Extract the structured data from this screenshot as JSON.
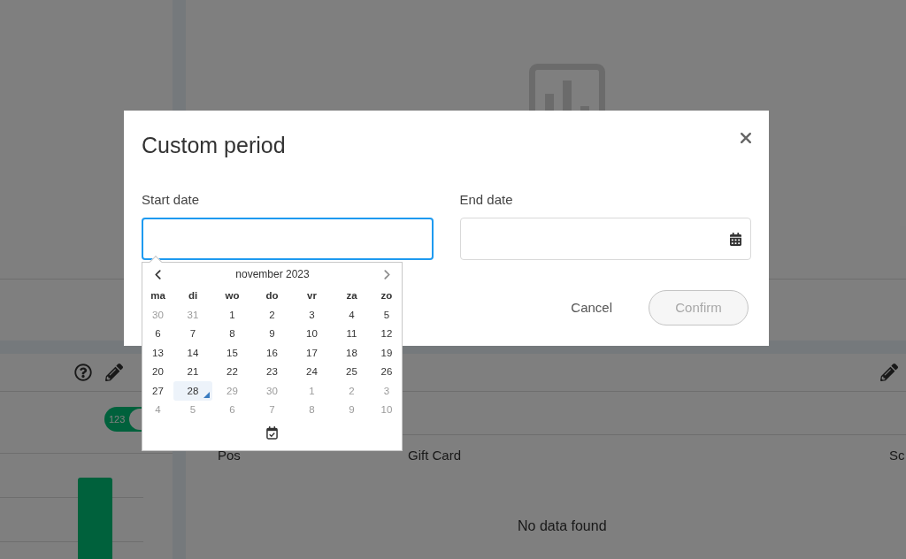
{
  "dashboard": {
    "switch": {
      "label": "123",
      "on": true
    },
    "table": {
      "columns": [
        "Pos",
        "Gift Card",
        "Sc"
      ],
      "empty_message": "No data found"
    }
  },
  "dialog": {
    "title": "Custom period",
    "fields": [
      {
        "label": "Start date",
        "focused": true
      },
      {
        "label": "End date",
        "focused": false
      }
    ],
    "buttons": [
      {
        "label": "Cancel",
        "kind": "text",
        "disabled": false
      },
      {
        "label": "Confirm",
        "kind": "outline",
        "disabled": true
      }
    ]
  },
  "datepicker": {
    "month": "november 2023",
    "prev_month": {
      "disabled": false
    },
    "next_month": {
      "disabled": true
    },
    "weekdays": [
      "ma",
      "di",
      "wo",
      "do",
      "vr",
      "za",
      "zo"
    ],
    "weeks": [
      [
        {
          "label": "30",
          "dimmed": true,
          "today": false
        },
        {
          "label": "31",
          "dimmed": true,
          "today": false
        },
        {
          "label": "1",
          "dimmed": false,
          "today": false
        },
        {
          "label": "2",
          "dimmed": false,
          "today": false
        },
        {
          "label": "3",
          "dimmed": false,
          "today": false
        },
        {
          "label": "4",
          "dimmed": false,
          "today": false
        },
        {
          "label": "5",
          "dimmed": false,
          "today": false
        }
      ],
      [
        {
          "label": "6",
          "dimmed": false,
          "today": false
        },
        {
          "label": "7",
          "dimmed": false,
          "today": false
        },
        {
          "label": "8",
          "dimmed": false,
          "today": false
        },
        {
          "label": "9",
          "dimmed": false,
          "today": false
        },
        {
          "label": "10",
          "dimmed": false,
          "today": false
        },
        {
          "label": "11",
          "dimmed": false,
          "today": false
        },
        {
          "label": "12",
          "dimmed": false,
          "today": false
        }
      ],
      [
        {
          "label": "13",
          "dimmed": false,
          "today": false
        },
        {
          "label": "14",
          "dimmed": false,
          "today": false
        },
        {
          "label": "15",
          "dimmed": false,
          "today": false
        },
        {
          "label": "16",
          "dimmed": false,
          "today": false
        },
        {
          "label": "17",
          "dimmed": false,
          "today": false
        },
        {
          "label": "18",
          "dimmed": false,
          "today": false
        },
        {
          "label": "19",
          "dimmed": false,
          "today": false
        }
      ],
      [
        {
          "label": "20",
          "dimmed": false,
          "today": false
        },
        {
          "label": "21",
          "dimmed": false,
          "today": false
        },
        {
          "label": "22",
          "dimmed": false,
          "today": false
        },
        {
          "label": "23",
          "dimmed": false,
          "today": false
        },
        {
          "label": "24",
          "dimmed": false,
          "today": false
        },
        {
          "label": "25",
          "dimmed": false,
          "today": false
        },
        {
          "label": "26",
          "dimmed": false,
          "today": false
        }
      ],
      [
        {
          "label": "27",
          "dimmed": false,
          "today": false
        },
        {
          "label": "28",
          "dimmed": false,
          "today": true
        },
        {
          "label": "29",
          "dimmed": true,
          "today": false
        },
        {
          "label": "30",
          "dimmed": true,
          "today": false
        },
        {
          "label": "1",
          "dimmed": true,
          "today": false
        },
        {
          "label": "2",
          "dimmed": true,
          "today": false
        },
        {
          "label": "3",
          "dimmed": true,
          "today": false
        }
      ],
      [
        {
          "label": "4",
          "dimmed": true,
          "today": false
        },
        {
          "label": "5",
          "dimmed": true,
          "today": false
        },
        {
          "label": "6",
          "dimmed": true,
          "today": false
        },
        {
          "label": "7",
          "dimmed": true,
          "today": false
        },
        {
          "label": "8",
          "dimmed": true,
          "today": false
        },
        {
          "label": "9",
          "dimmed": true,
          "today": false
        },
        {
          "label": "10",
          "dimmed": true,
          "today": false
        }
      ]
    ]
  }
}
